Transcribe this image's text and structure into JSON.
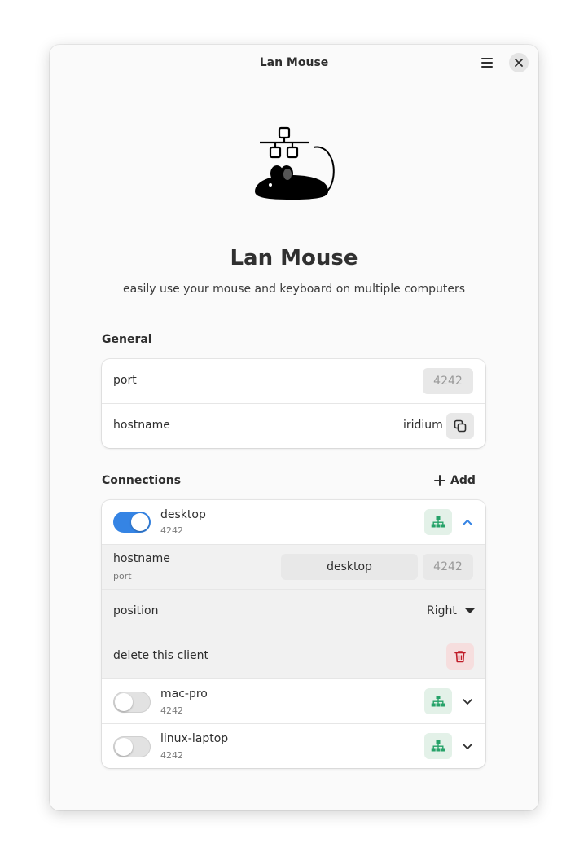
{
  "window": {
    "title": "Lan Mouse"
  },
  "app": {
    "name": "Lan Mouse",
    "subtitle": "easily use your mouse and keyboard on multiple computers"
  },
  "general": {
    "title": "General",
    "port_label": "port",
    "port_placeholder": "4242",
    "hostname_label": "hostname",
    "hostname_value": "iridium"
  },
  "connections": {
    "title": "Connections",
    "add_label": "Add",
    "clients": [
      {
        "name": "desktop",
        "port": "4242",
        "enabled": true,
        "expanded": true,
        "details": {
          "hostname_label": "hostname",
          "port_label": "port",
          "hostname_value": "desktop",
          "port_placeholder": "4242",
          "position_label": "position",
          "position_value": "Right",
          "delete_label": "delete this client"
        }
      },
      {
        "name": "mac-pro",
        "port": "4242",
        "enabled": false,
        "expanded": false
      },
      {
        "name": "linux-laptop",
        "port": "4242",
        "enabled": false,
        "expanded": false
      }
    ]
  },
  "colors": {
    "accent": "#3584e4",
    "success": "#26a269",
    "destructive": "#c01c28"
  },
  "icons": {
    "menu": "hamburger-menu-icon",
    "close": "close-icon",
    "copy": "copy-icon",
    "add": "plus-icon",
    "network": "network-status-icon",
    "expand": "chevron-down-icon",
    "collapse": "chevron-up-icon",
    "delete": "trash-icon",
    "dropdown": "triangle-down-icon"
  }
}
